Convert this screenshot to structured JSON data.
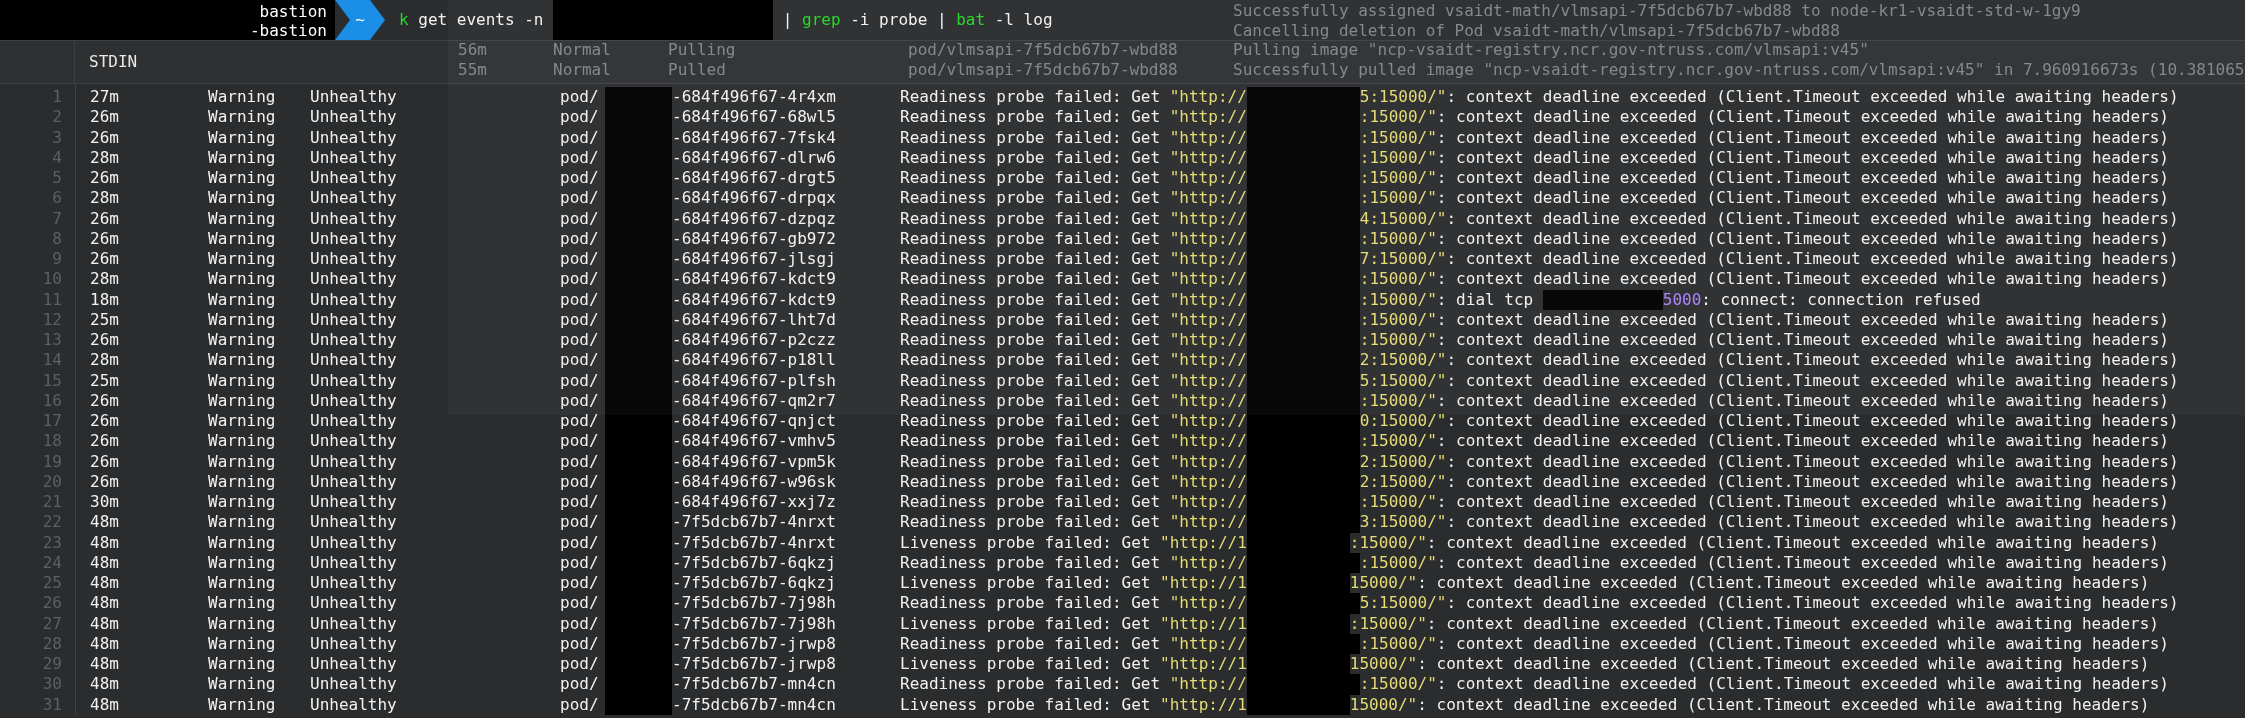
{
  "prompt": {
    "host_lines": [
      "bastion",
      "-bastion"
    ],
    "dir": "~",
    "command": [
      {
        "kind": "cmd",
        "text": "k"
      },
      {
        "kind": "plain",
        "text": " get events -n "
      },
      {
        "kind": "redacted"
      },
      {
        "kind": "plain",
        "text": " | "
      },
      {
        "kind": "cmd",
        "text": "grep"
      },
      {
        "kind": "plain",
        "text": " -i probe | "
      },
      {
        "kind": "cmd",
        "text": "bat"
      },
      {
        "kind": "plain",
        "text": " -l log"
      }
    ]
  },
  "header": {
    "title": "STDIN"
  },
  "background_window": {
    "rows": [
      {
        "message": "Successfully assigned vsaidt-math/vlmsapi-7f5dcb67b7-wbd88 to node-kr1-vsaidt-std-w-1gy9"
      },
      {
        "message": "Cancelling deletion of Pod vsaidt-math/vlmsapi-7f5dcb67b7-wbd88"
      },
      {
        "age": "56m",
        "type": "Normal",
        "reason": "Pulling",
        "object": "pod/vlmsapi-7f5dcb67b7-wbd88",
        "message": "Pulling image \"ncp-vsaidt-registry.ncr.gov-ntruss.com/vlmsapi:v45\""
      },
      {
        "age": "55m",
        "type": "Normal",
        "reason": "Pulled",
        "object": "pod/vlmsapi-7f5dcb67b7-wbd88",
        "message": "Successfully pulled image \"ncp-vsaidt-registry.ncr.gov-ntruss.com/vlmsapi:v45\" in 7.960916673s (10.381065"
      }
    ]
  },
  "rows": [
    {
      "n": "1",
      "pod_prefix": "pod/",
      "age": "27m",
      "type": "Warning",
      "reason": "Unhealthy",
      "pod": "-684f496f67-4r4xm",
      "probe": "Readiness probe failed: Get ",
      "url_start": "\"http://",
      "url_end": "5:15000/\"",
      "kind": "timeout",
      "message": ": context deadline exceeded (Client.Timeout exceeded while awaiting headers)"
    },
    {
      "n": "2",
      "pod_prefix": "pod/",
      "age": "26m",
      "type": "Warning",
      "reason": "Unhealthy",
      "pod": "-684f496f67-68wl5",
      "probe": "Readiness probe failed: Get ",
      "url_start": "\"http://",
      "url_end": ":15000/\"",
      "kind": "timeout",
      "message": ": context deadline exceeded (Client.Timeout exceeded while awaiting headers)"
    },
    {
      "n": "3",
      "pod_prefix": "pod/",
      "age": "26m",
      "type": "Warning",
      "reason": "Unhealthy",
      "pod": "-684f496f67-7fsk4",
      "probe": "Readiness probe failed: Get ",
      "url_start": "\"http://",
      "url_end": ":15000/\"",
      "kind": "timeout",
      "message": ": context deadline exceeded (Client.Timeout exceeded while awaiting headers)"
    },
    {
      "n": "4",
      "pod_prefix": "pod/",
      "age": "28m",
      "type": "Warning",
      "reason": "Unhealthy",
      "pod": "-684f496f67-dlrw6",
      "probe": "Readiness probe failed: Get ",
      "url_start": "\"http://",
      "url_end": ":15000/\"",
      "kind": "timeout",
      "message": ": context deadline exceeded (Client.Timeout exceeded while awaiting headers)"
    },
    {
      "n": "5",
      "pod_prefix": "pod/",
      "age": "26m",
      "type": "Warning",
      "reason": "Unhealthy",
      "pod": "-684f496f67-drgt5",
      "probe": "Readiness probe failed: Get ",
      "url_start": "\"http://",
      "url_end": ":15000/\"",
      "kind": "timeout",
      "message": ": context deadline exceeded (Client.Timeout exceeded while awaiting headers)"
    },
    {
      "n": "6",
      "pod_prefix": "pod/",
      "age": "28m",
      "type": "Warning",
      "reason": "Unhealthy",
      "pod": "-684f496f67-drpqx",
      "probe": "Readiness probe failed: Get ",
      "url_start": "\"http://",
      "url_end": ":15000/\"",
      "kind": "timeout",
      "message": ": context deadline exceeded (Client.Timeout exceeded while awaiting headers)"
    },
    {
      "n": "7",
      "pod_prefix": "pod/",
      "age": "26m",
      "type": "Warning",
      "reason": "Unhealthy",
      "pod": "-684f496f67-dzpqz",
      "probe": "Readiness probe failed: Get ",
      "url_start": "\"http://",
      "url_end": "4:15000/\"",
      "kind": "timeout",
      "message": ": context deadline exceeded (Client.Timeout exceeded while awaiting headers)"
    },
    {
      "n": "8",
      "pod_prefix": "pod/",
      "age": "26m",
      "type": "Warning",
      "reason": "Unhealthy",
      "pod": "-684f496f67-gb972",
      "probe": "Readiness probe failed: Get ",
      "url_start": "\"http://",
      "url_end": ":15000/\"",
      "kind": "timeout",
      "message": ": context deadline exceeded (Client.Timeout exceeded while awaiting headers)"
    },
    {
      "n": "9",
      "pod_prefix": "pod/",
      "age": "26m",
      "type": "Warning",
      "reason": "Unhealthy",
      "pod": "-684f496f67-jlsgj",
      "probe": "Readiness probe failed: Get ",
      "url_start": "\"http://",
      "url_end": "7:15000/\"",
      "kind": "timeout",
      "message": ": context deadline exceeded (Client.Timeout exceeded while awaiting headers)"
    },
    {
      "n": "10",
      "pod_prefix": "pod/",
      "age": "28m",
      "type": "Warning",
      "reason": "Unhealthy",
      "pod": "-684f496f67-kdct9",
      "probe": "Readiness probe failed: Get ",
      "url_start": "\"http://",
      "url_end": ":15000/\"",
      "kind": "timeout",
      "message": ": context deadline exceeded (Client.Timeout exceeded while awaiting headers)"
    },
    {
      "n": "11",
      "pod_prefix": "pod/",
      "age": "18m",
      "type": "Warning",
      "reason": "Unhealthy",
      "pod": "-684f496f67-kdct9",
      "probe": "Readiness probe failed: Get ",
      "url_start": "\"http://",
      "url_end": ":15000/\"",
      "kind": "refused",
      "dial": ": dial tcp ",
      "port": "5000",
      "message": ": connect: connection refused"
    },
    {
      "n": "12",
      "pod_prefix": "pod/",
      "age": "25m",
      "type": "Warning",
      "reason": "Unhealthy",
      "pod": "-684f496f67-lht7d",
      "probe": "Readiness probe failed: Get ",
      "url_start": "\"http://",
      "url_end": ":15000/\"",
      "kind": "timeout",
      "message": ": context deadline exceeded (Client.Timeout exceeded while awaiting headers)"
    },
    {
      "n": "13",
      "pod_prefix": "pod/",
      "age": "26m",
      "type": "Warning",
      "reason": "Unhealthy",
      "pod": "-684f496f67-p2czz",
      "probe": "Readiness probe failed: Get ",
      "url_start": "\"http://",
      "url_end": ":15000/\"",
      "kind": "timeout",
      "message": ": context deadline exceeded (Client.Timeout exceeded while awaiting headers)"
    },
    {
      "n": "14",
      "pod_prefix": "pod/",
      "age": "28m",
      "type": "Warning",
      "reason": "Unhealthy",
      "pod": "-684f496f67-p18ll",
      "probe": "Readiness probe failed: Get ",
      "url_start": "\"http://",
      "url_end": "2:15000/\"",
      "kind": "timeout",
      "message": ": context deadline exceeded (Client.Timeout exceeded while awaiting headers)"
    },
    {
      "n": "15",
      "pod_prefix": "pod/",
      "age": "25m",
      "type": "Warning",
      "reason": "Unhealthy",
      "pod": "-684f496f67-plfsh",
      "probe": "Readiness probe failed: Get ",
      "url_start": "\"http://",
      "url_end": "5:15000/\"",
      "kind": "timeout",
      "message": ": context deadline exceeded (Client.Timeout exceeded while awaiting headers)"
    },
    {
      "n": "16",
      "pod_prefix": "pod/",
      "age": "26m",
      "type": "Warning",
      "reason": "Unhealthy",
      "pod": "-684f496f67-qm2r7",
      "probe": "Readiness probe failed: Get ",
      "url_start": "\"http://",
      "url_end": ":15000/\"",
      "kind": "timeout",
      "message": ": context deadline exceeded (Client.Timeout exceeded while awaiting headers)"
    },
    {
      "n": "17",
      "pod_prefix": "pod/",
      "age": "26m",
      "type": "Warning",
      "reason": "Unhealthy",
      "pod": "-684f496f67-qnjct",
      "probe": "Readiness probe failed: Get ",
      "url_start": "\"http://",
      "url_end": "0:15000/\"",
      "kind": "timeout",
      "message": ": context deadline exceeded (Client.Timeout exceeded while awaiting headers)"
    },
    {
      "n": "18",
      "pod_prefix": "pod/",
      "age": "26m",
      "type": "Warning",
      "reason": "Unhealthy",
      "pod": "-684f496f67-vmhv5",
      "probe": "Readiness probe failed: Get ",
      "url_start": "\"http://",
      "url_end": ":15000/\"",
      "kind": "timeout",
      "message": ": context deadline exceeded (Client.Timeout exceeded while awaiting headers)"
    },
    {
      "n": "19",
      "pod_prefix": "pod/",
      "age": "26m",
      "type": "Warning",
      "reason": "Unhealthy",
      "pod": "-684f496f67-vpm5k",
      "probe": "Readiness probe failed: Get ",
      "url_start": "\"http://",
      "url_end": "2:15000/\"",
      "kind": "timeout",
      "message": ": context deadline exceeded (Client.Timeout exceeded while awaiting headers)"
    },
    {
      "n": "20",
      "pod_prefix": "pod/",
      "age": "26m",
      "type": "Warning",
      "reason": "Unhealthy",
      "pod": "-684f496f67-w96sk",
      "probe": "Readiness probe failed: Get ",
      "url_start": "\"http://",
      "url_end": "2:15000/\"",
      "kind": "timeout",
      "message": ": context deadline exceeded (Client.Timeout exceeded while awaiting headers)"
    },
    {
      "n": "21",
      "pod_prefix": "pod/",
      "age": "30m",
      "type": "Warning",
      "reason": "Unhealthy",
      "pod": "-684f496f67-xxj7z",
      "probe": "Readiness probe failed: Get ",
      "url_start": "\"http://",
      "url_end": ":15000/\"",
      "kind": "timeout",
      "message": ": context deadline exceeded (Client.Timeout exceeded while awaiting headers)"
    },
    {
      "n": "22",
      "pod_prefix": "pod/",
      "age": "48m",
      "type": "Warning",
      "reason": "Unhealthy",
      "pod": "-7f5dcb67b7-4nrxt",
      "probe": "Readiness probe failed: Get ",
      "url_start": "\"http://",
      "url_end": "3:15000/\"",
      "kind": "timeout",
      "message": ": context deadline exceeded (Client.Timeout exceeded while awaiting headers)"
    },
    {
      "n": "23",
      "pod_prefix": "pod/",
      "age": "48m",
      "type": "Warning",
      "reason": "Unhealthy",
      "pod": "-7f5dcb67b7-4nrxt",
      "probe": "Liveness probe failed: Get ",
      "url_start": "\"http://1",
      "url_end": ":15000/\"",
      "kind": "timeout",
      "message": ": context deadline exceeded (Client.Timeout exceeded while awaiting headers)"
    },
    {
      "n": "24",
      "pod_prefix": "pod/",
      "age": "48m",
      "type": "Warning",
      "reason": "Unhealthy",
      "pod": "-7f5dcb67b7-6qkzj",
      "probe": "Readiness probe failed: Get ",
      "url_start": "\"http://",
      "url_end": ":15000/\"",
      "kind": "timeout",
      "message": ": context deadline exceeded (Client.Timeout exceeded while awaiting headers)"
    },
    {
      "n": "25",
      "pod_prefix": "pod/",
      "age": "48m",
      "type": "Warning",
      "reason": "Unhealthy",
      "pod": "-7f5dcb67b7-6qkzj",
      "probe": "Liveness probe failed: Get ",
      "url_start": "\"http://1",
      "url_end": "15000/\"",
      "kind": "timeout",
      "message": ": context deadline exceeded (Client.Timeout exceeded while awaiting headers)"
    },
    {
      "n": "26",
      "pod_prefix": "pod/",
      "age": "48m",
      "type": "Warning",
      "reason": "Unhealthy",
      "pod": "-7f5dcb67b7-7j98h",
      "probe": "Readiness probe failed: Get ",
      "url_start": "\"http://",
      "url_end": "5:15000/\"",
      "kind": "timeout",
      "message": ": context deadline exceeded (Client.Timeout exceeded while awaiting headers)"
    },
    {
      "n": "27",
      "pod_prefix": "pod/",
      "age": "48m",
      "type": "Warning",
      "reason": "Unhealthy",
      "pod": "-7f5dcb67b7-7j98h",
      "probe": "Liveness probe failed: Get ",
      "url_start": "\"http://1",
      "url_end": ":15000/\"",
      "kind": "timeout",
      "message": ": context deadline exceeded (Client.Timeout exceeded while awaiting headers)"
    },
    {
      "n": "28",
      "pod_prefix": "pod/",
      "age": "48m",
      "type": "Warning",
      "reason": "Unhealthy",
      "pod": "-7f5dcb67b7-jrwp8",
      "probe": "Readiness probe failed: Get ",
      "url_start": "\"http://",
      "url_end": ":15000/\"",
      "kind": "timeout",
      "message": ": context deadline exceeded (Client.Timeout exceeded while awaiting headers)"
    },
    {
      "n": "29",
      "pod_prefix": "pod/",
      "age": "48m",
      "type": "Warning",
      "reason": "Unhealthy",
      "pod": "-7f5dcb67b7-jrwp8",
      "probe": "Liveness probe failed: Get ",
      "url_start": "\"http://1",
      "url_end": "15000/\"",
      "kind": "timeout",
      "message": ": context deadline exceeded (Client.Timeout exceeded while awaiting headers)"
    },
    {
      "n": "30",
      "pod_prefix": "pod/",
      "age": "48m",
      "type": "Warning",
      "reason": "Unhealthy",
      "pod": "-7f5dcb67b7-mn4cn",
      "probe": "Readiness probe failed: Get ",
      "url_start": "\"http://",
      "url_end": ":15000/\"",
      "kind": "timeout",
      "message": ": context deadline exceeded (Client.Timeout exceeded while awaiting headers)"
    },
    {
      "n": "31",
      "pod_prefix": "pod/",
      "age": "48m",
      "type": "Warning",
      "reason": "Unhealthy",
      "pod": "-7f5dcb67b7-mn4cn",
      "probe": "Liveness probe failed: Get ",
      "url_start": "\"http://1",
      "url_end": "15000/\"",
      "kind": "timeout",
      "message": ": context deadline exceeded (Client.Timeout exceeded while awaiting headers)"
    }
  ]
}
